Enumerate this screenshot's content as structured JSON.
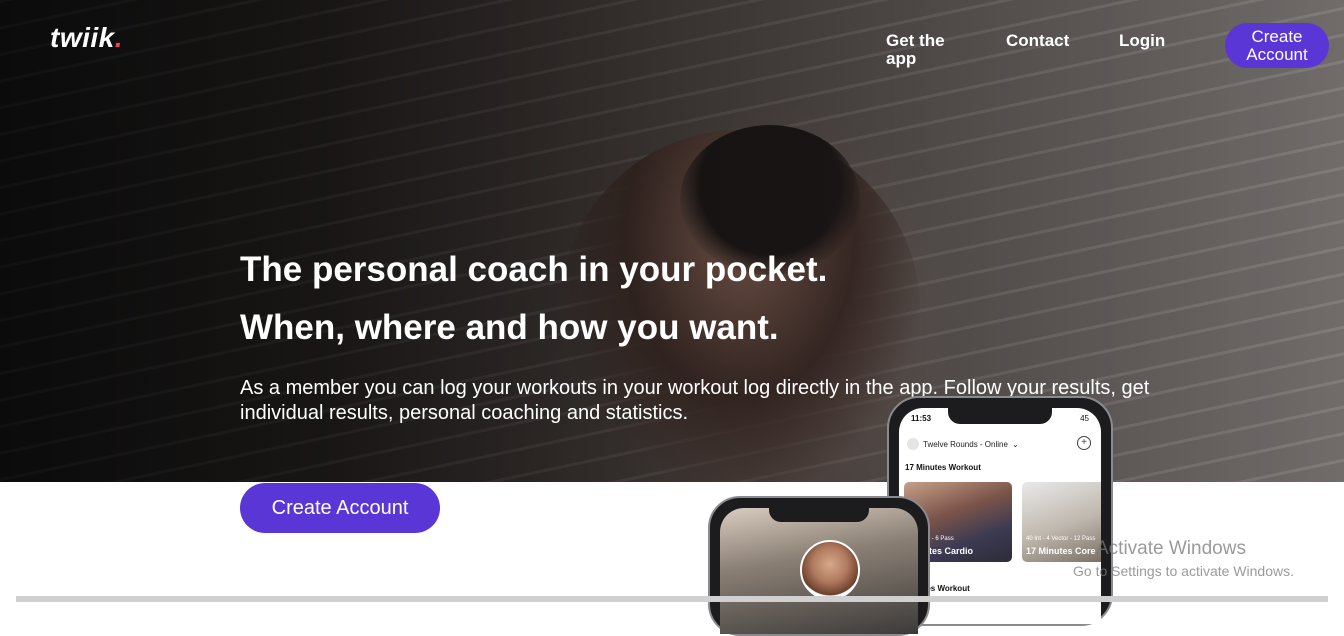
{
  "brand": {
    "logo_text": "twiik",
    "logo_dot": ".",
    "dot_color": "#e8415c"
  },
  "nav": {
    "get_app": "Get the app",
    "contact": "Contact",
    "login": "Login",
    "create_account": "Create Account"
  },
  "hero": {
    "headline_1": "The personal coach in your pocket.",
    "headline_2": "When, where and how you want.",
    "description": "As a member you can log your workouts in your workout log directly in the app. Follow your results, get individual results, personal coaching and statistics.",
    "cta": "Create Account"
  },
  "phone_app": {
    "time": "11:53",
    "battery": "45",
    "gym_selector": "Twelve Rounds - Online",
    "section_1": "17 Minutes Workout",
    "cards": [
      {
        "meta": "4 Vector - 6 Pass",
        "title": "Minutes Cardio"
      },
      {
        "meta": "40 Int - 4 Vector - 12 Pass",
        "title": "17 Minutes Core"
      }
    ],
    "section_2": "Minutes Workout"
  },
  "watermark": {
    "line1": "Activate Windows",
    "line2": "Go to Settings to activate Windows."
  },
  "colors": {
    "accent": "#5b36d6",
    "text_on_dark": "#ffffff"
  }
}
